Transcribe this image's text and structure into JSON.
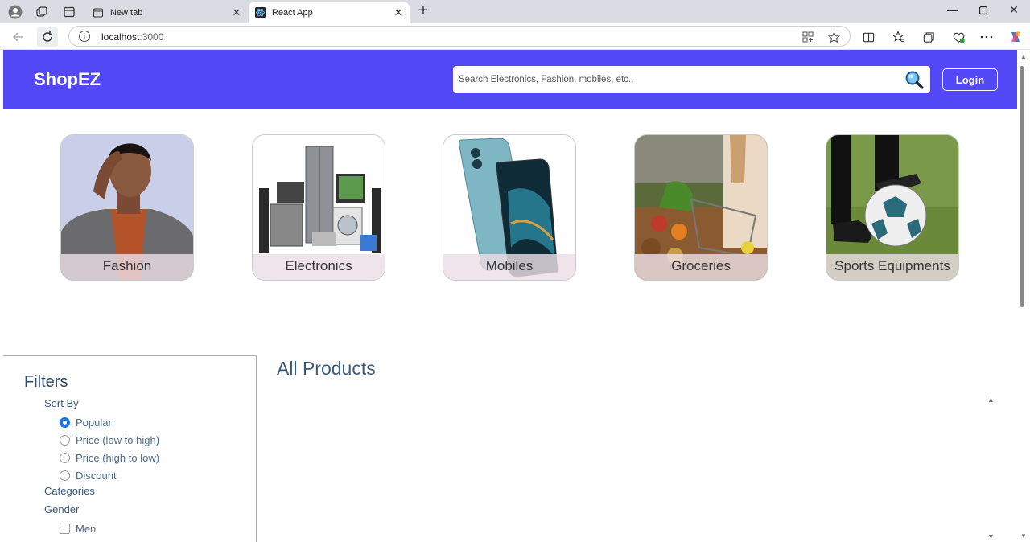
{
  "browser": {
    "tabs": [
      {
        "title": "New tab",
        "active": false
      },
      {
        "title": "React App",
        "active": true
      }
    ],
    "url_host": "localhost",
    "url_port": ":3000"
  },
  "navbar": {
    "brand": "ShopEZ",
    "search_placeholder": "Search Electronics, Fashion, mobiles, etc.,",
    "login_label": "Login",
    "bg_color": "#5348f5"
  },
  "categories": [
    {
      "label": "Fashion"
    },
    {
      "label": "Electronics"
    },
    {
      "label": "Mobiles"
    },
    {
      "label": "Groceries"
    },
    {
      "label": "Sports Equipments"
    }
  ],
  "filters": {
    "title": "Filters",
    "sort_by_label": "Sort By",
    "sort_options": [
      {
        "label": "Popular",
        "selected": true
      },
      {
        "label": "Price (low to high)",
        "selected": false
      },
      {
        "label": "Price (high to low)",
        "selected": false
      },
      {
        "label": "Discount",
        "selected": false
      }
    ],
    "categories_label": "Categories",
    "gender_label": "Gender",
    "gender_options": [
      {
        "label": "Men",
        "checked": false
      }
    ]
  },
  "main": {
    "heading": "All Products"
  }
}
